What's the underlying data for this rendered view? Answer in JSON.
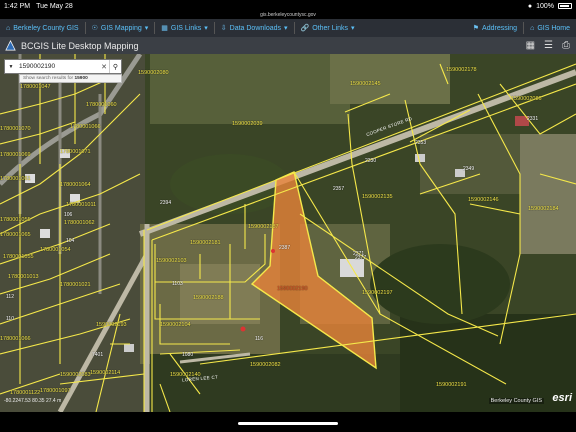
{
  "status_bar": {
    "time": "1:42 PM",
    "date": "Tue May 28",
    "battery": "100%"
  },
  "browser": {
    "url": "gis.berkeleycountysc.gov"
  },
  "nav": {
    "county_gis": "Berkeley County GIS",
    "gis_mapping": "GIS Mapping",
    "gis_links": "GIS Links",
    "data_downloads": "Data Downloads",
    "other_links": "Other Links",
    "addressing": "Addressing",
    "gis_home": "GIS Home"
  },
  "app": {
    "title": "BCGIS Lite Desktop Mapping"
  },
  "search": {
    "value": "1590002190",
    "hint_prefix": "Show search results for ",
    "hint_bold": "15900"
  },
  "colors": {
    "parcel_line": "#f5e84a",
    "selected_parcel": "#e8833a",
    "nav_link": "#5bc0f8"
  },
  "map": {
    "parcel_labels": [
      "1590002080",
      "1590002145",
      "1590002178",
      "1590002086",
      "1780001047",
      "1780001060",
      "1780001070",
      "1780001066",
      "1780001069",
      "1780001071",
      "1590002039",
      "1780001061",
      "1780001064",
      "1780001055",
      "1780001062",
      "1780001065",
      "1780001011",
      "1780001055",
      "1780001054",
      "1780001013",
      "1780001021",
      "1590002181",
      "1590002135",
      "1590002103",
      "1590002146",
      "1590002187",
      "1590002184",
      "1590002197",
      "1590002188",
      "1590002193",
      "1590002104",
      "1780001066",
      "1590002191",
      "1590002082",
      "1590002083",
      "1590002114",
      "1590002140",
      "1780001122",
      "1780001097"
    ],
    "selected_label": "1590002190",
    "addresses": [
      "2330",
      "2353",
      "2357",
      "2349",
      "2394",
      "2371",
      "2387",
      "2377",
      "2331",
      "106",
      "104",
      "112",
      "110",
      "1103",
      "7401",
      "1080",
      "116"
    ],
    "roads": [
      "COOPER STORE RD",
      "LOREN LEE CT"
    ]
  },
  "footer": {
    "coords": "-80.2247.53 80.35 27.4 m",
    "attribution": "Berkeley County GIS",
    "esri": "esri"
  }
}
